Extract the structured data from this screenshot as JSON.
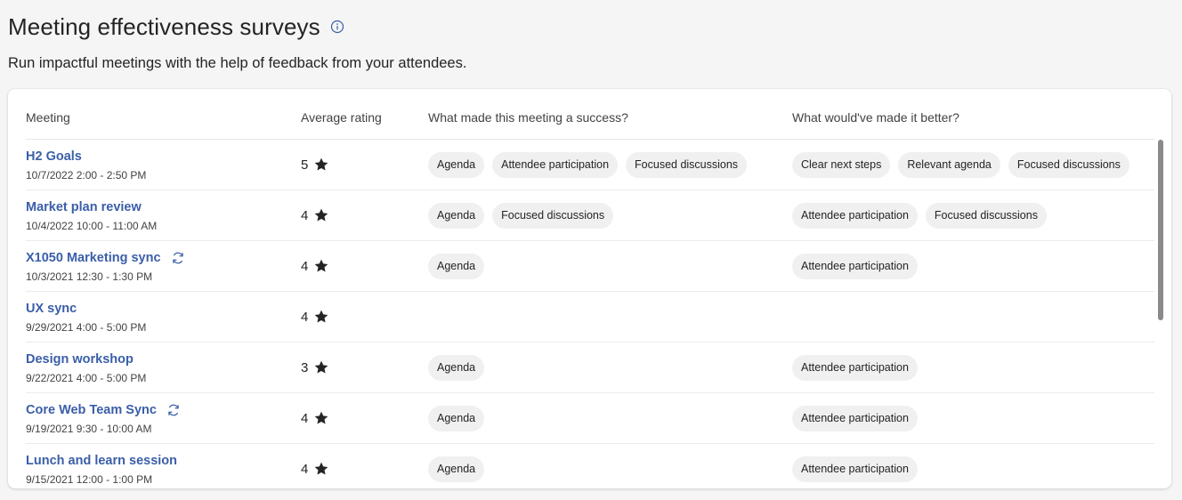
{
  "page": {
    "title": "Meeting effectiveness surveys",
    "subtitle": "Run impactful meetings with the help of feedback from your attendees."
  },
  "table": {
    "headers": {
      "meeting": "Meeting",
      "rating": "Average rating",
      "success": "What made this meeting a success?",
      "better": "What would've made it better?"
    },
    "rows": [
      {
        "name": "H2 Goals",
        "date": "10/7/2022  2:00 - 2:50 PM",
        "recurring": false,
        "rating": "5",
        "success": [
          "Agenda",
          "Attendee participation",
          "Focused discussions"
        ],
        "better": [
          "Clear next steps",
          "Relevant agenda",
          "Focused discussions"
        ]
      },
      {
        "name": "Market plan review",
        "date": "10/4/2022  10:00 - 11:00 AM",
        "recurring": false,
        "rating": "4",
        "success": [
          "Agenda",
          "Focused discussions"
        ],
        "better": [
          "Attendee participation",
          "Focused discussions"
        ]
      },
      {
        "name": "X1050 Marketing sync",
        "date": "10/3/2021  12:30 - 1:30 PM",
        "recurring": true,
        "rating": "4",
        "success": [
          "Agenda"
        ],
        "better": [
          "Attendee participation"
        ]
      },
      {
        "name": "UX sync",
        "date": "9/29/2021  4:00 - 5:00 PM",
        "recurring": false,
        "rating": "4",
        "success": [],
        "better": []
      },
      {
        "name": "Design workshop",
        "date": "9/22/2021  4:00 - 5:00 PM",
        "recurring": false,
        "rating": "3",
        "success": [
          "Agenda"
        ],
        "better": [
          "Attendee participation"
        ]
      },
      {
        "name": "Core Web Team Sync",
        "date": "9/19/2021  9:30 - 10:00 AM",
        "recurring": true,
        "rating": "4",
        "success": [
          "Agenda"
        ],
        "better": [
          "Attendee participation"
        ]
      },
      {
        "name": "Lunch and learn session",
        "date": "9/15/2021  12:00 - 1:00 PM",
        "recurring": false,
        "rating": "4",
        "success": [
          "Agenda"
        ],
        "better": [
          "Attendee participation"
        ]
      }
    ]
  },
  "icons": {
    "info": "info-icon",
    "star": "star-icon",
    "recurring": "recurring-icon"
  },
  "colors": {
    "link": "#3a5ea8",
    "tag_bg": "#f0f0f0",
    "info": "#3a5ea8"
  }
}
